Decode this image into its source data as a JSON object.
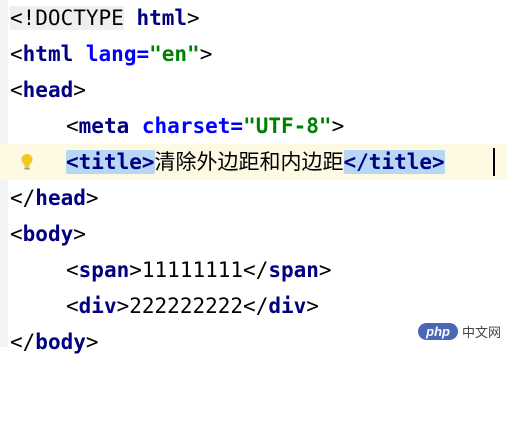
{
  "editor": {
    "lines": [
      {
        "doctype": "<!DOCTYPE",
        "html": "html",
        "close": ">"
      },
      {
        "open": "<",
        "tag": "html",
        "attr": "lang",
        "eq": "=",
        "value": "\"en\"",
        "close": ">"
      },
      {
        "open": "<",
        "tag": "head",
        "close": ">"
      },
      {
        "open": "<",
        "tag": "meta",
        "attr": "charset",
        "eq": "=",
        "value": "\"UTF-8\"",
        "close": ">"
      },
      {
        "open_tag": "<title>",
        "text": "清除外边距和内边距",
        "close_tag": "</title>"
      },
      {
        "open": "</",
        "tag": "head",
        "close": ">"
      },
      {
        "open": "<",
        "tag": "body",
        "close": ">"
      },
      {
        "open": "<",
        "tag": "span",
        "close": ">",
        "text": "11111111",
        "copen": "</",
        "ctag": "span",
        "cclose": ">"
      },
      {
        "open": "<",
        "tag": "div",
        "close": ">",
        "text": "222222222",
        "copen": "</",
        "ctag": "div",
        "cclose": ">"
      },
      {
        "open": "</",
        "tag": "body",
        "close": ">"
      }
    ],
    "hint_icon": "lightbulb-icon"
  },
  "watermark": {
    "logo": "php",
    "text": "中文网"
  },
  "colors": {
    "tag": "#000080",
    "attribute": "#0000ff",
    "string": "#008000",
    "current_line": "#fdf9e3",
    "tag_match_highlight": "#b7d7f5"
  }
}
